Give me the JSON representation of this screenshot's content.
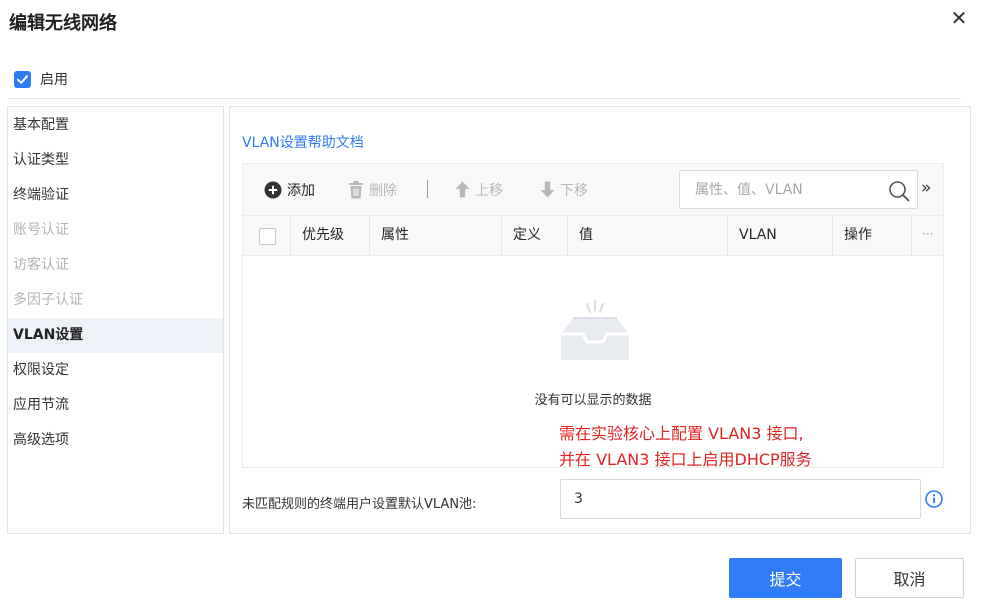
{
  "dialog": {
    "title": "编辑无线网络",
    "close_glyph": "✕"
  },
  "enable": {
    "label": "启用",
    "checked": true
  },
  "sidebar": {
    "items": [
      {
        "label": "基本配置",
        "state": "normal"
      },
      {
        "label": "认证类型",
        "state": "normal"
      },
      {
        "label": "终端验证",
        "state": "normal"
      },
      {
        "label": "账号认证",
        "state": "disabled"
      },
      {
        "label": "访客认证",
        "state": "disabled"
      },
      {
        "label": "多因子认证",
        "state": "disabled"
      },
      {
        "label": "VLAN设置",
        "state": "active"
      },
      {
        "label": "权限设定",
        "state": "normal"
      },
      {
        "label": "应用节流",
        "state": "normal"
      },
      {
        "label": "高级选项",
        "state": "normal"
      }
    ]
  },
  "main": {
    "help_link": "VLAN设置帮助文档",
    "toolbar": {
      "add_label": "添加",
      "delete_label": "删除",
      "separator": "|",
      "move_up_label": "上移",
      "move_down_label": "下移",
      "more_glyph": "»"
    },
    "search": {
      "placeholder": "属性、值、VLAN"
    },
    "table": {
      "columns": [
        "优先级",
        "属性",
        "定义",
        "值",
        "VLAN",
        "操作"
      ],
      "more_glyph": "···",
      "rows": [],
      "empty_text": "没有可以显示的数据"
    },
    "annotation": {
      "line1": "需在实验核心上配置 VLAN3 接口,",
      "line2": "并在 VLAN3 接口上启用DHCP服务"
    },
    "default_vlan_pool": {
      "label": "未匹配规则的终端用户设置默认VLAN池:",
      "value": "3"
    }
  },
  "footer": {
    "submit_label": "提交",
    "cancel_label": "取消"
  },
  "colors": {
    "accent": "#2f7cf6",
    "annotation": "#e02424",
    "active_item_bg": "#edf1f8",
    "disabled_text": "#b3b3b3"
  },
  "icons": [
    "close-icon",
    "checkbox-checked-icon",
    "plus-circle-icon",
    "trash-icon",
    "arrow-up-icon",
    "arrow-down-icon",
    "search-icon",
    "double-chevron-right-icon",
    "empty-inbox-icon",
    "info-icon"
  ]
}
